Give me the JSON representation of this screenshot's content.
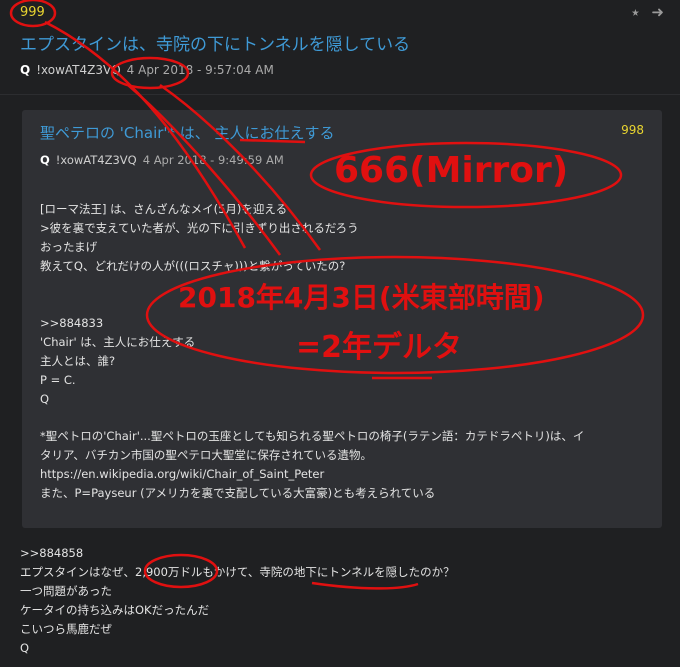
{
  "main_post": {
    "number": "999",
    "title": "エプスタインは、寺院の下にトンネルを隠している",
    "poster": "Q",
    "tripcode": "!xowAT4Z3VQ",
    "date": "4 Apr 2018 - 9:57:04 AM"
  },
  "header_icons": [
    "share-icon",
    "arrow-circle-right-icon"
  ],
  "quoted_post": {
    "number": "998",
    "title": "聖ペテロの 'Chair'* は、 主人にお仕えする",
    "poster": "Q",
    "tripcode": "!xowAT4Z3VQ",
    "date": "4 Apr 2018 - 9:49:59 AM",
    "lines_block1": [
      "[ローマ法王] は、さんざんなメイ(5月)を迎える",
      ">彼を裏で支えていた者が、光の下に引きずり出されるだろう",
      "おったまげ",
      "教えてQ、どれだけの人が(((ロスチャ)))と繋がっていたの?"
    ],
    "lines_block2": [
      ">>884833",
      "'Chair' は、主人にお仕えする",
      "主人とは、誰?",
      "P = C.",
      "Q"
    ],
    "lines_block3": [
      "*聖ペトロの'Chair'...聖ペトロの玉座としても知られる聖ペトロの椅子(ラテン語：カテドラペトリ)は、イ",
      "タリア、バチカン市国の聖ペテロ大聖堂に保存されている遺物。",
      "https://en.wikipedia.org/wiki/Chair_of_Saint_Peter",
      "また、P=Payseur (アメリカを裏で支配している大富豪)とも考えられている"
    ]
  },
  "answer": {
    "lines": [
      ">>884858",
      "エプスタインはなぜ、2,900万ドルもかけて、寺院の地下にトンネルを隠したのか？",
      "一つ問題があった",
      "ケータイの持ち込みはOKだったんだ",
      "こいつら馬鹿だぜ",
      "Q"
    ]
  },
  "annotations": {
    "mirror": "666(Mirror)",
    "date_note": "2018年4月3日(米東部時間)",
    "delta_note": "=2年デルタ",
    "color": "#e01010"
  }
}
